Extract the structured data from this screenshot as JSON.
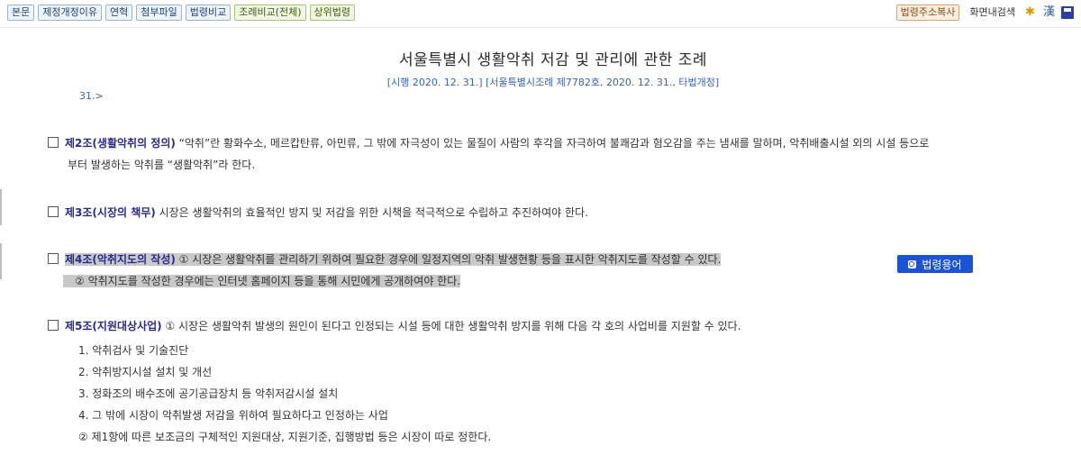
{
  "toolbar": {
    "left_buttons": [
      "본문",
      "제정개정이유",
      "연혁",
      "첨부파일",
      "법령비교"
    ],
    "green_buttons": [
      "조례비교(전체)",
      "상위법령"
    ],
    "copy_address": "법령주소복사",
    "page_search": "화면내검색",
    "icons": [
      "star-icon",
      "hanja-icon",
      "save-icon"
    ]
  },
  "doc": {
    "title": "서울특별시 생활악취 저감 및 관리에 관한 조례",
    "subtitle": "[시행 2020. 12. 31.] [서울특별시조례 제7782호, 2020. 12. 31., 타법개정]",
    "continuation": "31.>"
  },
  "articles": {
    "a2": {
      "head": "제2조(생활악취의 정의)",
      "line1": " “악취”란 황화수소, 메르캅탄류, 아민류, 그 밖에 자극성이 있는 물질이 사람의 후각을 자극하여 불쾌감과 혐오감을 주는 냄새를 말하며, 악취배출시설 외의 시설 등으로",
      "line2": "부터 발생하는 악취를 “생활악취”라 한다."
    },
    "a3": {
      "head": "제3조(시장의 책무)",
      "line1": " 시장은 생활악취의 효율적인 방지 및 저감을 위한 시책을 적극적으로 수립하고 추진하여야 한다."
    },
    "a4": {
      "head": "제4조(악취지도의 작성)",
      "line1": " ① 시장은 생활악취를 관리하기 위하여 필요한 경우에 일정지역의 악취 발생현황 등을 표시한 악취지도를 작성할 수 있다.",
      "line2": "② 악취지도를 작성한 경우에는 인터넷 홈페이지 등을 통해 시민에게 공개하여야 한다."
    },
    "a5": {
      "head": "제5조(지원대상사업)",
      "line1": " ① 시장은 생활악취 발생의 원인이 된다고 인정되는 시설 등에 대한 생활악취 방지를 위해 다음 각 호의 사업비를 지원할 수 있다.",
      "items": [
        "1. 악취검사 및 기술진단",
        "2. 악취방지시설 설치 및 개선",
        "3. 정화조의 배수조에 공기공급장치 등 악취저감시설 설치",
        "4. 그 밖에 시장이 악취발생 저감을 위하여 필요하다고 인정하는 사업"
      ],
      "para2": "② 제1항에 따른 보조금의 구체적인 지원대상, 지원기준, 집행방법 등은 시장이 따로 정한다."
    }
  },
  "term_button": "법령용어"
}
